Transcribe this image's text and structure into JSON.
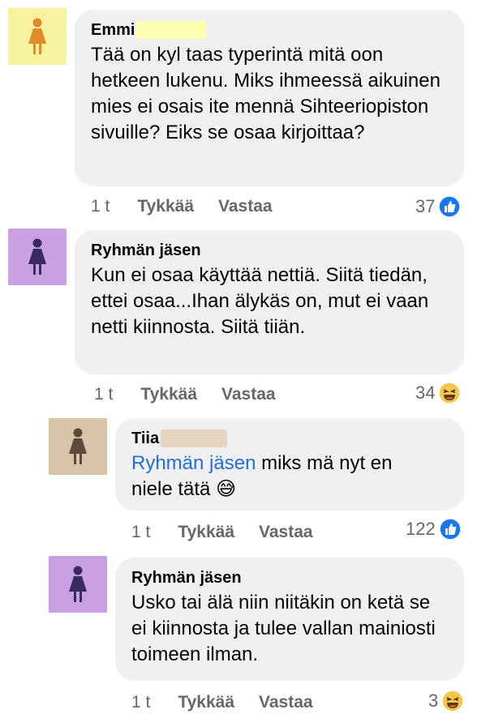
{
  "comments": [
    {
      "author": "Emmi",
      "avatar_color": "#f6f29d",
      "figure_color": "#e08a2a",
      "text": "Tää on kyl taas typerintä mitä oon hetkeen lukenu. Miks ihmeessä aikuinen mies ei osais ite mennä Sihteeriopiston sivuille? Eiks se osaa kirjoittaa?",
      "time": "1 t",
      "like_label": "Tykkää",
      "reply_label": "Vastaa",
      "reaction_count": "37",
      "reaction_icon": "like-icon"
    },
    {
      "author": "Ryhmän jäsen",
      "avatar_color": "#c9a0e3",
      "figure_color": "#3b2a5e",
      "text": "Kun ei osaa käyttää nettiä. Siitä tiedän, ettei osaa...Ihan älykäs on, mut ei vaan netti kiinnosta. Siitä tiiän.",
      "time": "1 t",
      "like_label": "Tykkää",
      "reply_label": "Vastaa",
      "reaction_count": "34",
      "reaction_icon": "haha-icon"
    },
    {
      "author": "Tiia",
      "avatar_color": "#d9c3a9",
      "figure_color": "#5c4a3b",
      "mention": "Ryhmän jäsen",
      "text": "miks mä nyt en niele tätä",
      "emoji": "😅",
      "time": "1 t",
      "like_label": "Tykkää",
      "reply_label": "Vastaa",
      "reaction_count": "122",
      "reaction_icon": "like-icon"
    },
    {
      "author": "Ryhmän jäsen",
      "avatar_color": "#c9a0e3",
      "figure_color": "#3b2a5e",
      "text": "Usko tai älä niin niitäkin on ketä se ei kiinnosta ja tulee vallan mainiosti toimeen ilman.",
      "time": "1 t",
      "like_label": "Tykkää",
      "reply_label": "Vastaa",
      "reaction_count": "3",
      "reaction_icon": "haha-icon"
    }
  ],
  "colors": {
    "like_blue": "#1877f2",
    "haha_yellow": "#f7c64a",
    "redaction_yellow": "#ffffb0",
    "redaction_tan": "#e6d3c1"
  }
}
